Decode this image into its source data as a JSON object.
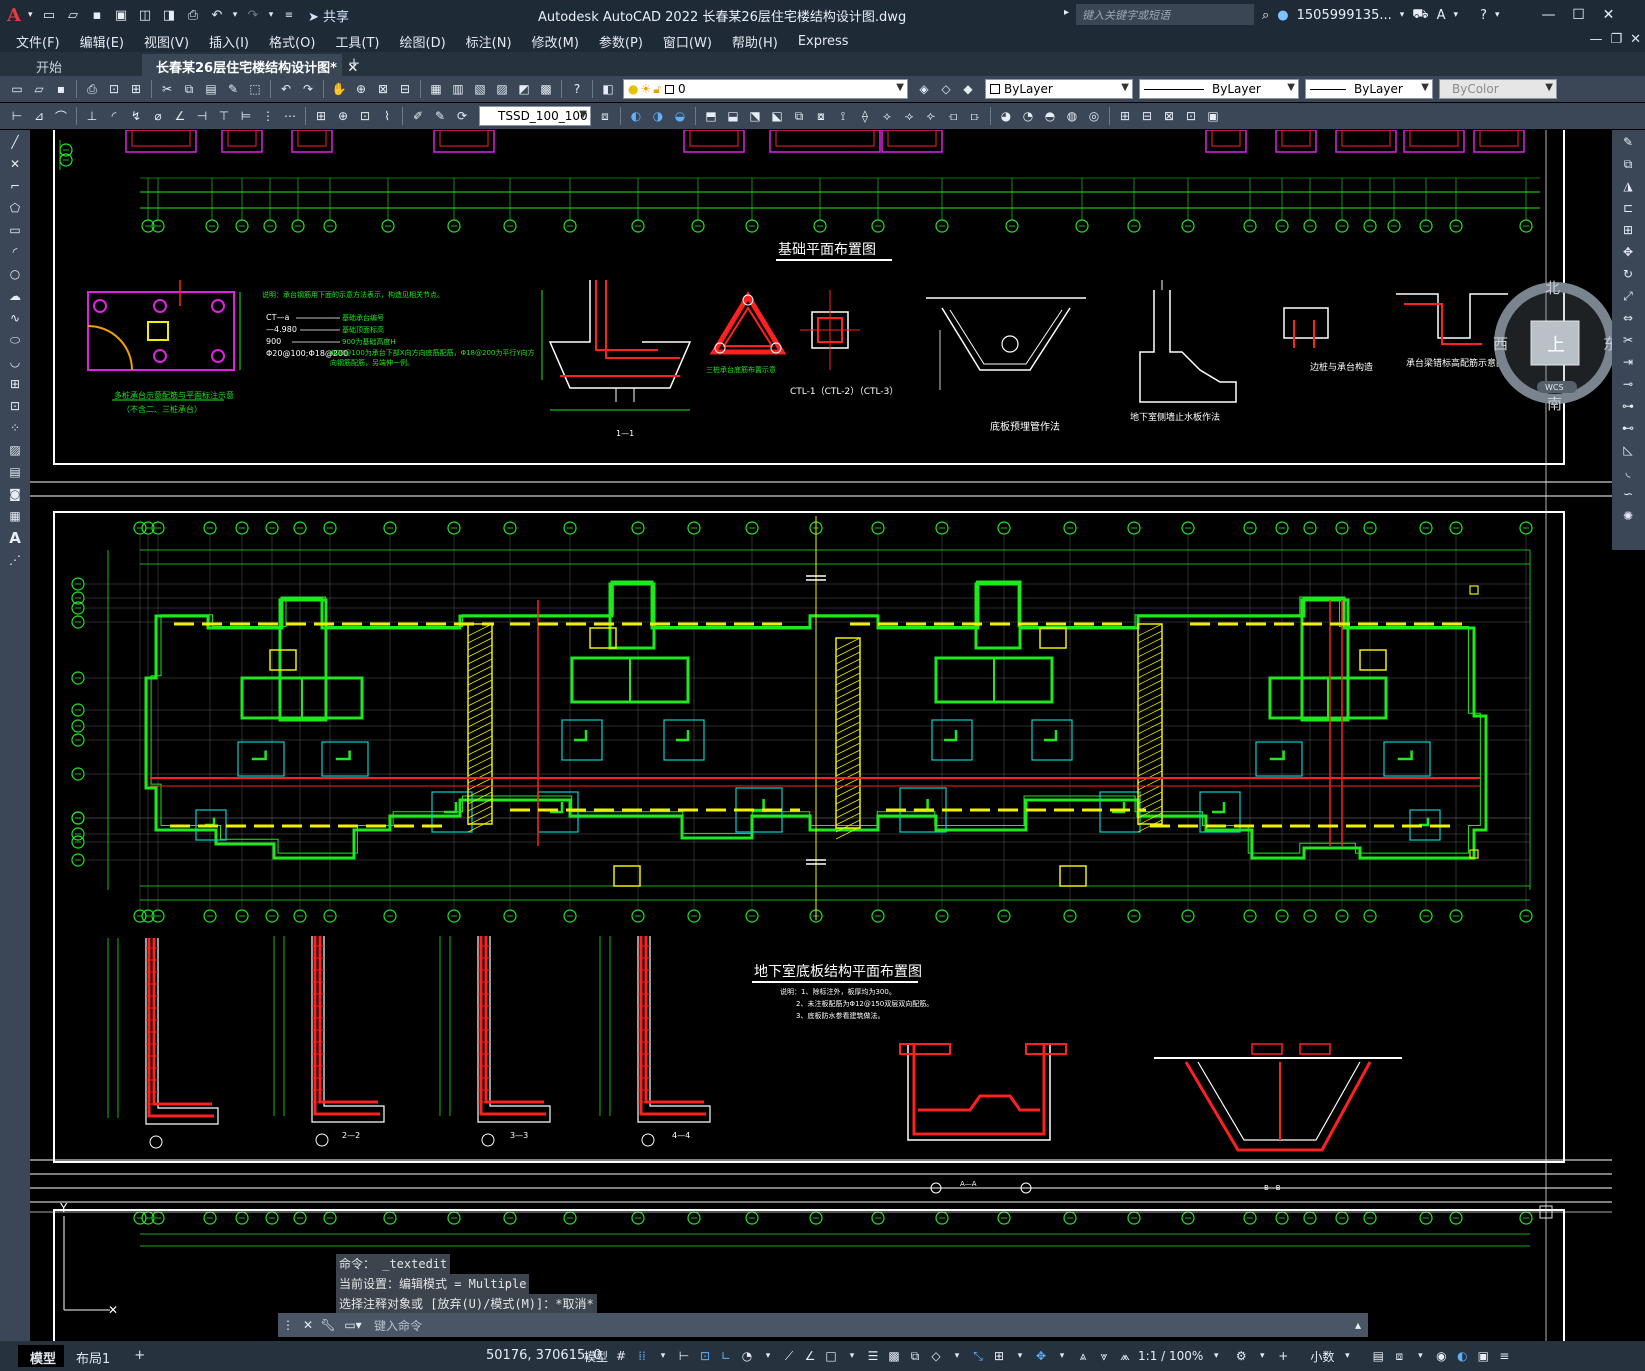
{
  "titlebar": {
    "app_logo": "A",
    "share_label": "共享",
    "title": "Autodesk AutoCAD 2022    长春某26层住宅楼结构设计图.dwg",
    "search_placeholder": "键入关键字或短语",
    "user": "1505999135...",
    "colors": {
      "bg": "#1f2a37",
      "logo": "#e43b3b"
    }
  },
  "menu": {
    "items": [
      "文件(F)",
      "编辑(E)",
      "视图(V)",
      "插入(I)",
      "格式(O)",
      "工具(T)",
      "绘图(D)",
      "标注(N)",
      "修改(M)",
      "参数(P)",
      "窗口(W)",
      "帮助(H)",
      "Express"
    ]
  },
  "tabs": {
    "start": "开始",
    "active": "长春某26层住宅楼结构设计图*",
    "add": "+"
  },
  "toolbar": {
    "layer_value": "0",
    "color_value": "ByLayer",
    "linetype_value": "ByLayer",
    "lineweight_value": "ByLayer",
    "plotstyle_value": "ByColor",
    "dimstyle_value": "TSSD_100_100"
  },
  "drawing": {
    "background": "#000000",
    "colors": {
      "green": "#1ee81e",
      "red": "#ff2020",
      "yellow": "#f0f000",
      "cyan": "#00d0d0",
      "magenta": "#e020e0",
      "white": "#ffffff",
      "grey": "#9a9a9a"
    },
    "titles": {
      "foundation_plan": "基础平面布置图",
      "basement_plan": "地下室底板结构平面布置图"
    },
    "detail_labels": {
      "cap_marking": "多桩承台示意配筋与平面标注示意",
      "cap_note": "（不含二、三桩承台）",
      "section_1": "1—1",
      "three_pile": "三桩承台底筋布置示意",
      "ctl_label": "CTL-1（CTL-2）（CTL-3）",
      "pit_detail": "底板预埋管作法",
      "water_stop": "地下室侧墙止水板作法",
      "pile_cap": "边桩与承台构造",
      "cap_beam": "承台梁错标高配筋示意图",
      "section_2": "2—2",
      "section_3": "3—3",
      "section_4": "4—4",
      "section_A": "A—A",
      "section_B": "B—B"
    },
    "cap_legend": {
      "heading": "说明：承台钢筋用下面的示意方法表示，构造见相关节点。",
      "lines": [
        "CT—a",
        "—4.980",
        "900",
        "Φ20@100;Φ18@200"
      ],
      "descs": [
        "基础承台编号",
        "基础顶面标高",
        "900为基础高度H",
        "Φ20@100为承台下部X向方向底筋配筋，Φ18@200为平行Y向方向钢筋配筋，另端伸一例。"
      ]
    },
    "basement_notes": [
      "说明：1、除标注外，板厚均为300。",
      "2、未注板配筋为Φ12@150双层双向配筋。",
      "3、底板防水参看建筑做法。"
    ],
    "compass": {
      "north": "北",
      "south": "南",
      "east": "东",
      "west": "西",
      "top": "上",
      "wcs": "WCS"
    },
    "axis_y": "Y"
  },
  "command": {
    "history": [
      "命令： _textedit",
      "当前设置：编辑模式 = Multiple",
      "选择注释对象或 [放弃(U)/模式(M)]：*取消*"
    ],
    "placeholder": "键入命令"
  },
  "status": {
    "tab_model": "模型",
    "tab_layout": "布局1",
    "tab_add": "+",
    "coords": "50176, 370615, 0",
    "model_label": "模型",
    "scale": "1:1 / 100%",
    "units": "小数"
  }
}
